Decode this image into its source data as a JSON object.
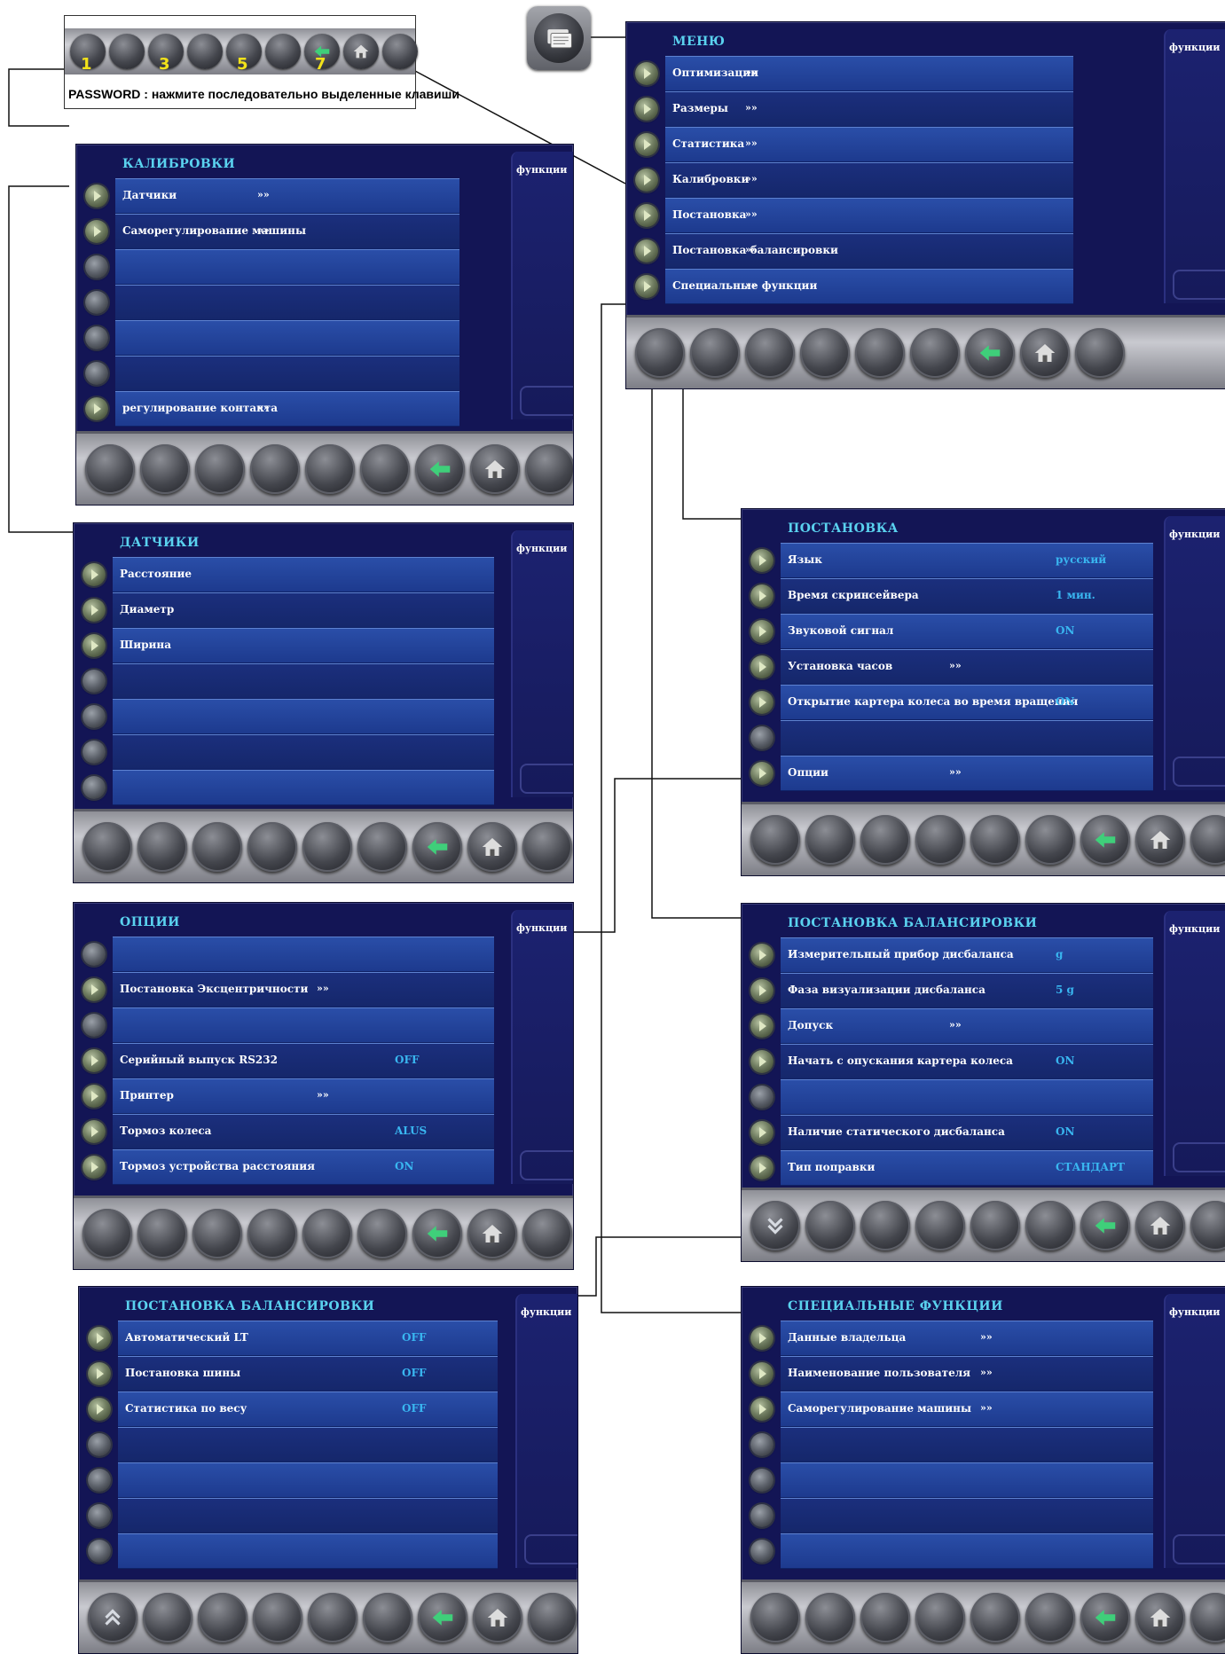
{
  "password": {
    "caption": "PASSWORD : нажмите последовательно выделенные клавиши",
    "numbers": [
      "1",
      "3",
      "5",
      "7"
    ]
  },
  "side_label": "функции",
  "arrows": "»»",
  "screens": {
    "menu": {
      "title": "МЕНЮ",
      "rows": [
        {
          "label": "Оптимизации",
          "arrow": true
        },
        {
          "label": "Размеры",
          "arrow": true
        },
        {
          "label": "Статистика",
          "arrow": true
        },
        {
          "label": "Калибровки",
          "arrow": true
        },
        {
          "label": "Постановка",
          "arrow": true
        },
        {
          "label": "Постановка балансировки",
          "arrow": true
        },
        {
          "label": "Специальные функции",
          "arrow": true
        }
      ]
    },
    "calibrations": {
      "title": "КАЛИБРОВКИ",
      "rows": [
        {
          "label": "Датчики",
          "arrow": true
        },
        {
          "label": "Саморегулирование машины",
          "arrow": true
        },
        {
          "label": ""
        },
        {
          "label": ""
        },
        {
          "label": ""
        },
        {
          "label": ""
        },
        {
          "label": "регулирование контакта",
          "arrow": true
        }
      ]
    },
    "setup": {
      "title": "ПОСТАНОВКА",
      "rows": [
        {
          "label": "Язык",
          "value": "русский"
        },
        {
          "label": "Время скринсейвера",
          "value": "1 мин."
        },
        {
          "label": "Звуковой сигнал",
          "value": "ON"
        },
        {
          "label": "Установка часов",
          "arrow": true
        },
        {
          "label": "Открытие картера колеса во время вращения",
          "value": "ON"
        },
        {
          "label": ""
        },
        {
          "label": "Опции",
          "arrow": true
        }
      ]
    },
    "sensors": {
      "title": "ДАТЧИКИ",
      "rows": [
        {
          "label": "Расстояние"
        },
        {
          "label": "Диаметр"
        },
        {
          "label": "Ширина"
        },
        {
          "label": ""
        },
        {
          "label": ""
        },
        {
          "label": ""
        },
        {
          "label": ""
        }
      ]
    },
    "options": {
      "title": "ОПЦИИ",
      "rows": [
        {
          "label": ""
        },
        {
          "label": "Постановка Эксцентричности",
          "arrow": true
        },
        {
          "label": ""
        },
        {
          "label": "Серийный выпуск RS232",
          "value": "OFF"
        },
        {
          "label": "Принтер",
          "arrow": true
        },
        {
          "label": "Тормоз колеса",
          "value": "ALUS"
        },
        {
          "label": "Тормоз устройства расстояния",
          "value": "ON"
        }
      ]
    },
    "balancing": {
      "title": "ПОСТАНОВКА БАЛАНСИРОВКИ",
      "rows": [
        {
          "label": "Измерительный прибор дисбаланса",
          "value": "g"
        },
        {
          "label": "Фаза визуализации дисбаланса",
          "value": "5 g"
        },
        {
          "label": "Допуск",
          "arrow": true
        },
        {
          "label": "Начать с опускания картера колеса",
          "value": "ON"
        },
        {
          "label": ""
        },
        {
          "label": "Наличие статического дисбаланса",
          "value": "ON"
        },
        {
          "label": "Тип поправки",
          "value": "СТАНДАРТ"
        }
      ]
    },
    "balancing2": {
      "title": "ПОСТАНОВКА БАЛАНСИРОВКИ",
      "rows": [
        {
          "label": "Автоматический LT",
          "value": "OFF"
        },
        {
          "label": "Постановка шины",
          "value": "OFF"
        },
        {
          "label": "Статистика по весу",
          "value": "OFF"
        },
        {
          "label": ""
        },
        {
          "label": ""
        },
        {
          "label": ""
        },
        {
          "label": ""
        }
      ]
    },
    "special": {
      "title": "СПЕЦИАЛЬНЫЕ ФУНКЦИИ",
      "rows": [
        {
          "label": "Данные владельца",
          "arrow": true
        },
        {
          "label": "Наименование пользователя",
          "arrow": true
        },
        {
          "label": "Саморегулирование машины",
          "arrow": true
        },
        {
          "label": ""
        },
        {
          "label": ""
        },
        {
          "label": ""
        },
        {
          "label": ""
        }
      ]
    }
  }
}
